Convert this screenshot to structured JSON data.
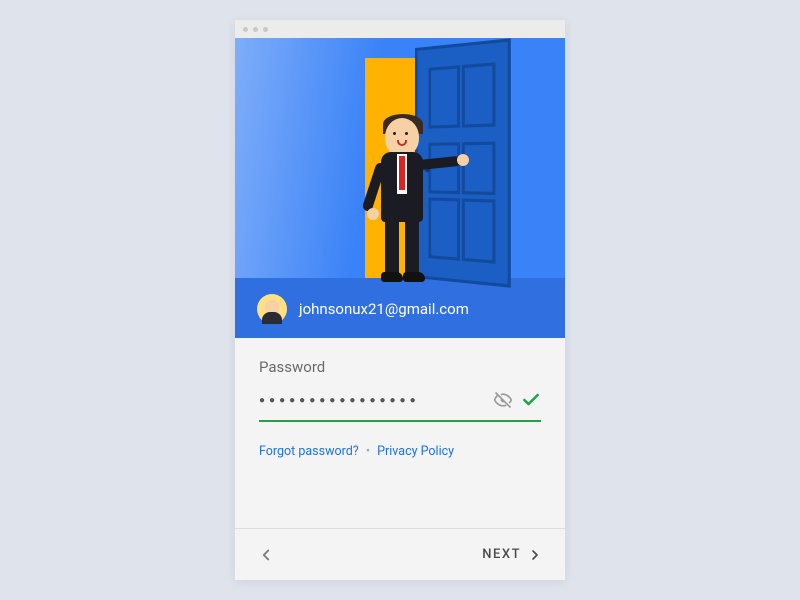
{
  "account": {
    "email": "johnsonux21@gmail.com"
  },
  "form": {
    "password_label": "Password",
    "password_mask": "●●●●●●●●●●●●●●●●",
    "forgot_link": "Forgot password?",
    "separator": "•",
    "privacy_link": "Privacy Policy"
  },
  "nav": {
    "next_label": "NEXT"
  },
  "colors": {
    "accent_blue": "#3a82f7",
    "link_blue": "#1a73e8",
    "success_green": "#1fa24a"
  }
}
